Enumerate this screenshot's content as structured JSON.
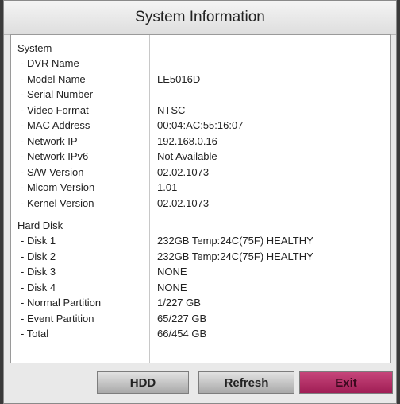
{
  "window": {
    "title": "System Information"
  },
  "system": {
    "heading": "System",
    "rows": [
      {
        "label": "- DVR Name",
        "value": ""
      },
      {
        "label": "- Model Name",
        "value": "LE5016D"
      },
      {
        "label": "- Serial Number",
        "value": ""
      },
      {
        "label": "- Video Format",
        "value": "NTSC"
      },
      {
        "label": "- MAC Address",
        "value": "00:04:AC:55:16:07"
      },
      {
        "label": "- Network IP",
        "value": "192.168.0.16"
      },
      {
        "label": "- Network IPv6",
        "value": "Not Available"
      },
      {
        "label": "- S/W Version",
        "value": "02.02.1073"
      },
      {
        "label": "- Micom Version",
        "value": "1.01"
      },
      {
        "label": "- Kernel Version",
        "value": "02.02.1073"
      }
    ]
  },
  "hard_disk": {
    "heading": "Hard Disk",
    "rows": [
      {
        "label": "- Disk 1",
        "value": "232GB Temp:24C(75F) HEALTHY"
      },
      {
        "label": "- Disk 2",
        "value": "232GB Temp:24C(75F) HEALTHY"
      },
      {
        "label": "- Disk 3",
        "value": "NONE"
      },
      {
        "label": "- Disk 4",
        "value": "NONE"
      },
      {
        "label": "- Normal Partition",
        "value": "1/227 GB"
      },
      {
        "label": "- Event Partition",
        "value": "65/227 GB"
      },
      {
        "label": "- Total",
        "value": "66/454 GB"
      }
    ]
  },
  "buttons": {
    "hdd": "HDD",
    "refresh": "Refresh",
    "exit": "Exit"
  },
  "colors": {
    "exit_button": "#b42a63",
    "panel": "#ffffff",
    "dialog": "#e9e9e9"
  }
}
